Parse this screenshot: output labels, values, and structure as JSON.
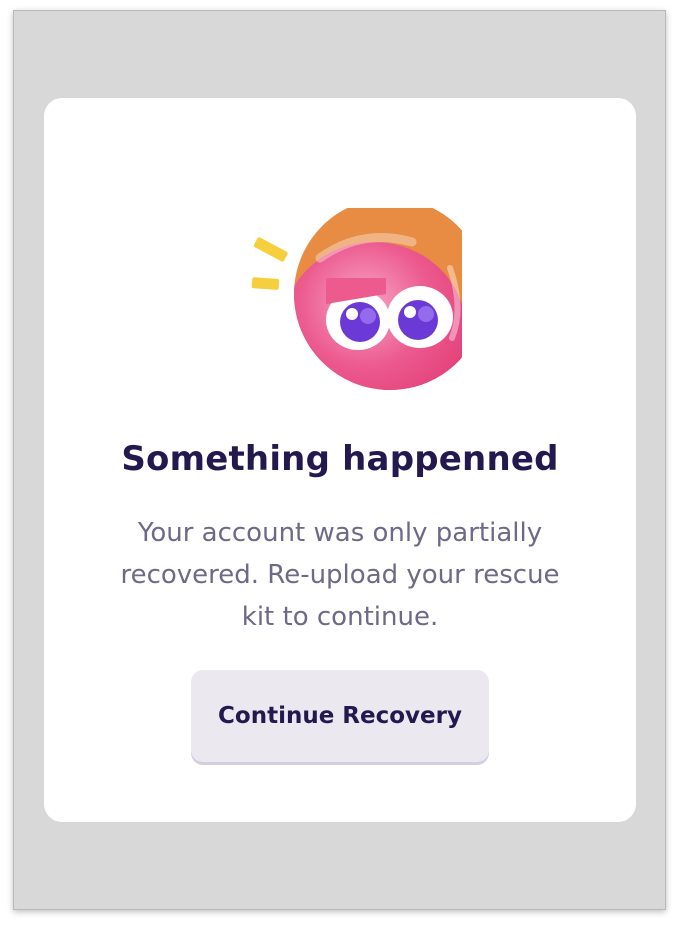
{
  "dialog": {
    "title": "Something happenned",
    "message": "Your account was only partially recovered. Re-upload your rescue kit to continue.",
    "button_label": "Continue Recovery",
    "illustration_icon": "worried-pink-blob-icon"
  },
  "colors": {
    "title": "#24194f",
    "message": "#6d6a87",
    "button_bg": "#ebe8f0",
    "orange_circle": "#e98c43",
    "pink_blob": "#ec5a8e",
    "iris": "#6b39d6",
    "spark": "#f6cf3e",
    "backdrop": "#d8d8d8"
  }
}
